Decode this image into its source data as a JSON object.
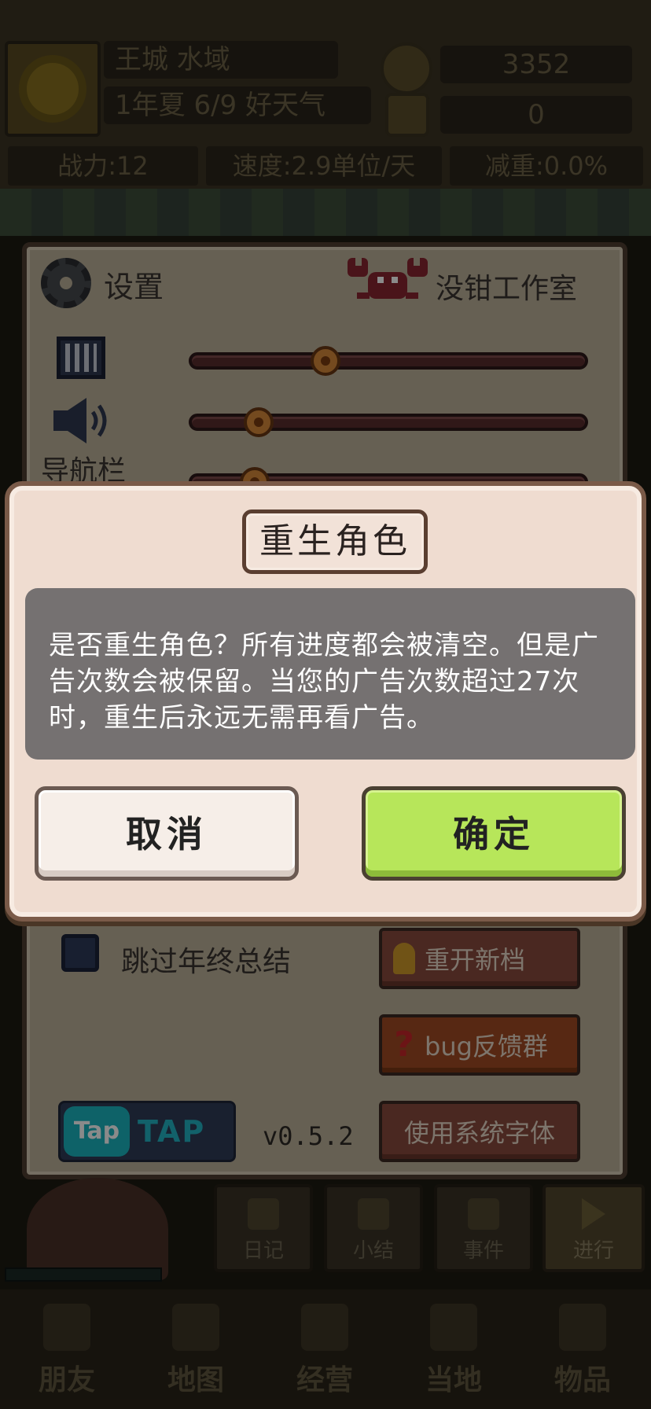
{
  "hud": {
    "location": "王城 水域",
    "date": "1年夏 6/9 好天气",
    "gold": "3352",
    "gems": "0",
    "power": "战力:12",
    "speed": "速度:2.9单位/天",
    "reduction": "减重:0.0%"
  },
  "settings": {
    "title": "设置",
    "studio": "没钳工作室",
    "navbar_label": "导航栏",
    "music_volume": 0.34,
    "sound_volume": 0.17,
    "third_slider": 0.16,
    "skip_summary_label": "跳过年终总结",
    "skip_summary_checked": false,
    "new_save_label": "重开新档",
    "bug_group_label": "bug反馈群",
    "system_font_label": "使用系统字体",
    "taptap_badge": "Tap",
    "taptap_text": "TAP",
    "version": "v0.5.2"
  },
  "action_tabs": [
    {
      "label": "日记"
    },
    {
      "label": "小结"
    },
    {
      "label": "事件"
    },
    {
      "label": "进行"
    }
  ],
  "bottom_nav": [
    {
      "label": "朋友"
    },
    {
      "label": "地图"
    },
    {
      "label": "经营"
    },
    {
      "label": "当地"
    },
    {
      "label": "物品"
    }
  ],
  "dialog": {
    "title": "重生角色",
    "message": "是否重生角色？所有进度都会被清空。但是广告次数会被保留。当您的广告次数超过27次时，重生后永远无需再看广告。",
    "cancel_label": "取消",
    "confirm_label": "确定"
  },
  "colors": {
    "confirm": "#b7e65a",
    "cancel": "#f6eee8",
    "message_bg": "#757171",
    "slider_knob": "#d68a3a"
  }
}
